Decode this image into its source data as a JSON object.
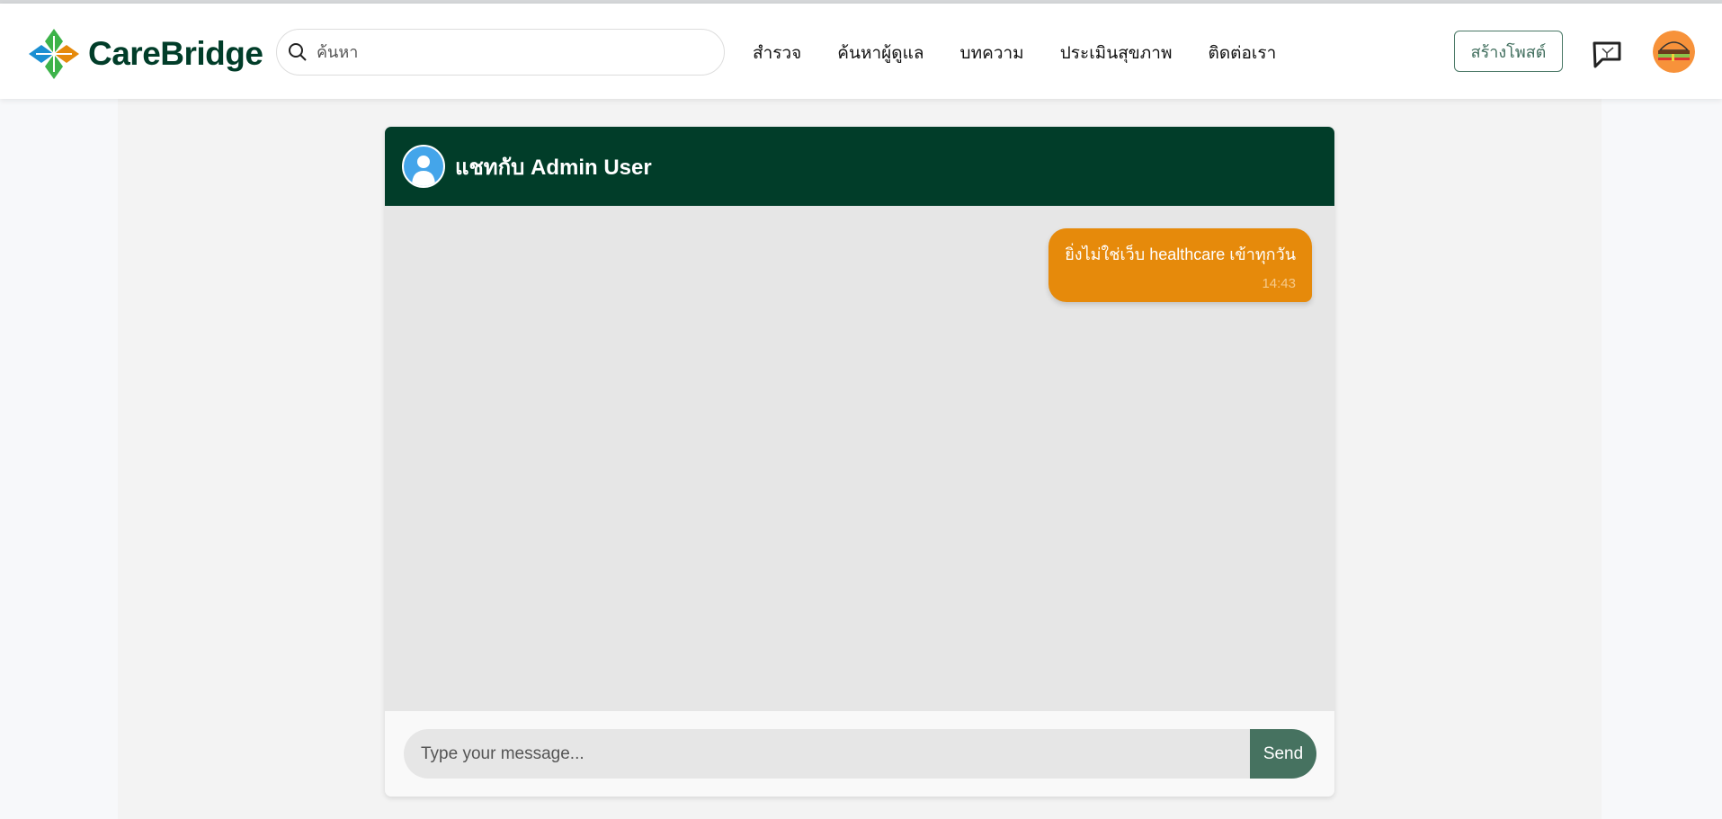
{
  "header": {
    "logo_text": "CareBridge",
    "search_placeholder": "ค้นหา",
    "nav": [
      "สำรวจ",
      "ค้นหาผู้ดูแล",
      "บทความ",
      "ประเมินสุขภาพ",
      "ติดต่อเรา"
    ],
    "create_post_label": "สร้างโพสต์"
  },
  "chat": {
    "title": "แชทกับ Admin User",
    "messages": [
      {
        "text": "ยิ่งไม่ใช่เว็บ healthcare เข้าทุกวัน",
        "time": "14:43",
        "sender": "me"
      }
    ],
    "input_placeholder": "Type your message...",
    "send_label": "Send"
  },
  "colors": {
    "brand_dark": "#013d29",
    "bubble": "#e68a0b",
    "send": "#467260"
  }
}
